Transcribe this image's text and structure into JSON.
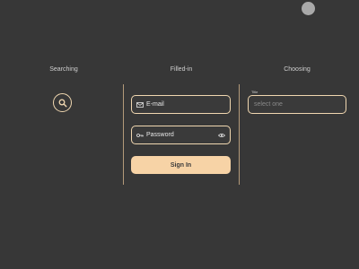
{
  "colors": {
    "background": "#373737",
    "accent": "#f0d7b0",
    "button_fill": "#f7d3a6",
    "divider": "#b39a7a"
  },
  "columns": {
    "searching": {
      "title": "Searching",
      "icon": "search-icon"
    },
    "filled_in": {
      "title": "Filled-in",
      "email_value": "E-mail",
      "email_icon": "mail-icon",
      "password_value": "Password",
      "password_icon": "key-icon",
      "password_trailing_icon": "eye-icon",
      "submit_label": "Sign In"
    },
    "choosing": {
      "title": "Choosing",
      "field_label": "Title",
      "placeholder": "select one"
    }
  }
}
